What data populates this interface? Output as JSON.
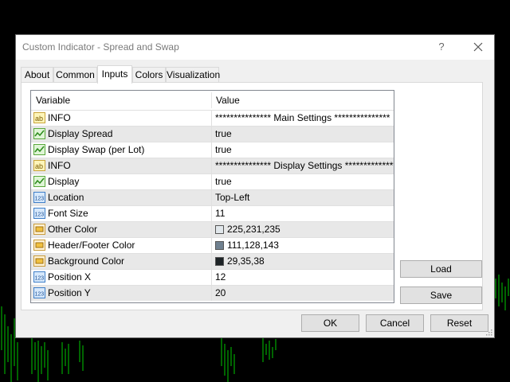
{
  "window": {
    "title": "Custom Indicator - Spread and Swap",
    "help_label": "?"
  },
  "tabs": [
    {
      "label": "About"
    },
    {
      "label": "Common"
    },
    {
      "label": "Inputs",
      "active": true
    },
    {
      "label": "Colors"
    },
    {
      "label": "Visualization"
    }
  ],
  "grid": {
    "columns": [
      "Variable",
      "Value"
    ],
    "rows": [
      {
        "icon": "string-icon",
        "name": "INFO",
        "value": "*************** Main Settings ***************"
      },
      {
        "icon": "bool-icon",
        "name": "Display Spread",
        "value": "true"
      },
      {
        "icon": "bool-icon",
        "name": "Display Swap (per Lot)",
        "value": "true"
      },
      {
        "icon": "string-icon",
        "name": "INFO",
        "value": "*************** Display Settings ***************"
      },
      {
        "icon": "bool-icon",
        "name": "Display",
        "value": "true"
      },
      {
        "icon": "int-icon",
        "name": "Location",
        "value": "Top-Left"
      },
      {
        "icon": "int-icon",
        "name": "Font Size",
        "value": "11"
      },
      {
        "icon": "color-icon",
        "name": "Other Color",
        "value": "225,231,235",
        "swatch": "#e1e7eb"
      },
      {
        "icon": "color-icon",
        "name": "Header/Footer Color",
        "value": "111,128,143",
        "swatch": "#6f808f"
      },
      {
        "icon": "color-icon",
        "name": "Background Color",
        "value": "29,35,38",
        "swatch": "#1d2326"
      },
      {
        "icon": "int-icon",
        "name": "Position X",
        "value": "12"
      },
      {
        "icon": "int-icon",
        "name": "Position Y",
        "value": "20"
      }
    ]
  },
  "side_buttons": {
    "load": "Load",
    "save": "Save"
  },
  "footer_buttons": {
    "ok": "OK",
    "cancel": "Cancel",
    "reset": "Reset"
  },
  "colors": {
    "chart_bars": "#00c800",
    "dialog_bg": "#f0f0f0"
  }
}
